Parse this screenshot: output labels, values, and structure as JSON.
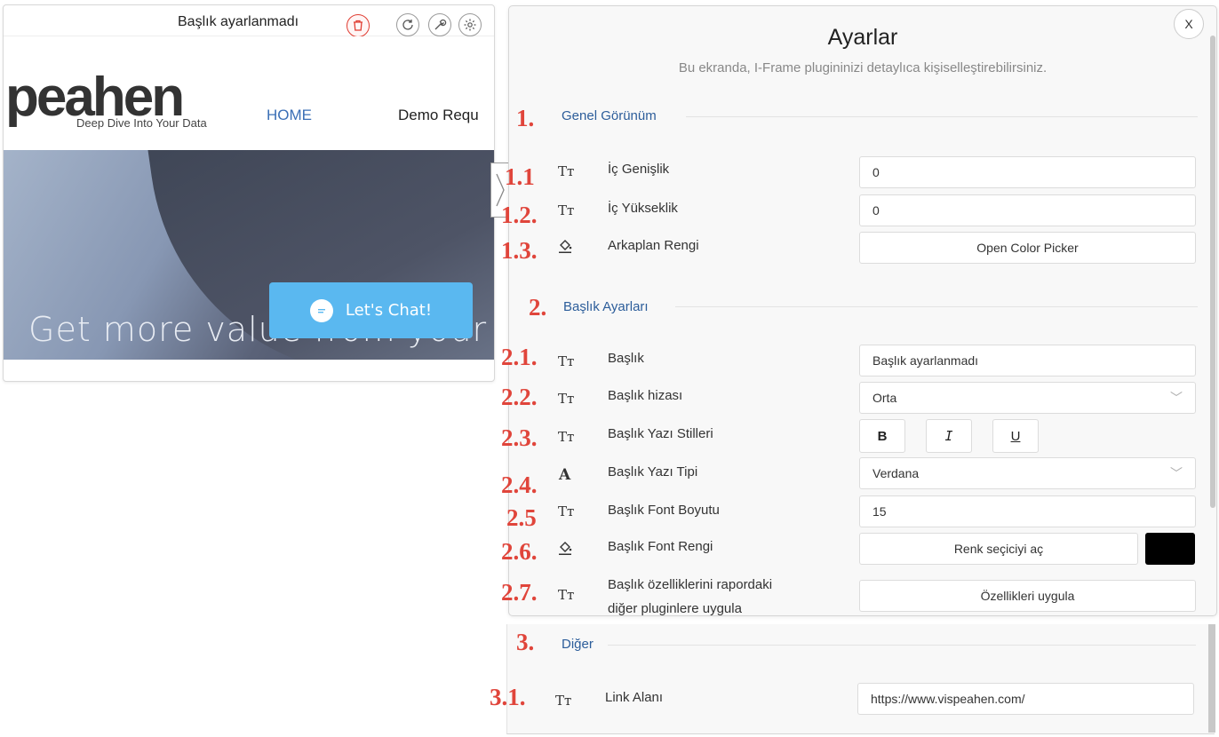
{
  "plugin": {
    "title": "Başlık ayarlanmadı",
    "logo": "peahen",
    "tagline": "Deep Dive Into Your Data",
    "nav_home": "HOME",
    "nav_demo": "Demo Requ",
    "hero_text": "Get more value from your data",
    "chat_label": "Let's Chat!"
  },
  "panel": {
    "title": "Ayarlar",
    "subtitle": "Bu ekranda, I-Frame plugininizi detaylıca kişiselleştirebilirsiniz.",
    "close": "X",
    "sections": [
      {
        "title": "Genel Görünüm",
        "rows": [
          {
            "icon": "text-icon",
            "label": "İç Genişlik",
            "value": "0"
          },
          {
            "icon": "text-icon",
            "label": "İç Yükseklik",
            "value": "0"
          },
          {
            "icon": "fill-icon",
            "label": "Arkaplan Rengi",
            "button": "Open Color Picker"
          }
        ]
      },
      {
        "title": "Başlık Ayarları",
        "rows": [
          {
            "icon": "text-icon",
            "label": "Başlık",
            "value": "Başlık ayarlanmadı"
          },
          {
            "icon": "text-icon",
            "label": "Başlık hizası",
            "value": "Orta"
          },
          {
            "icon": "text-icon",
            "label": "Başlık Yazı Stilleri",
            "styles": [
              "B",
              "I",
              "U"
            ]
          },
          {
            "icon": "font-icon",
            "label": "Başlık Yazı Tipi",
            "value": "Verdana"
          },
          {
            "icon": "text-icon",
            "label": "Başlık Font Boyutu",
            "value": "15"
          },
          {
            "icon": "fill-icon",
            "label": "Başlık Font Rengi",
            "button": "Renk seçiciyi aç",
            "color": "#000000"
          },
          {
            "icon": "text-icon",
            "label_line1": "Başlık özelliklerini rapordaki",
            "label_line2": "diğer pluginlere uygula",
            "button": "Özellikleri uygula"
          }
        ]
      },
      {
        "title": "Diğer",
        "rows": [
          {
            "icon": "text-icon",
            "label": "Link Alanı",
            "value": "https://www.vispeahen.com/"
          }
        ]
      }
    ]
  },
  "glyphs": {
    "text_icon": "Tт",
    "font_icon": "A",
    "chevron": "﹀"
  },
  "annotations": [
    "1.",
    "1.1",
    "1.2.",
    "1.3.",
    "2.",
    "2.1.",
    "2.2.",
    "2.3.",
    "2.4.",
    "2.5",
    "2.6.",
    "2.7.",
    "3.",
    "3.1."
  ],
  "colors": {
    "accent": "#2c5d9a",
    "annotation": "#e0453b",
    "chat": "#5ab8f0",
    "delete": "#e03c31"
  }
}
